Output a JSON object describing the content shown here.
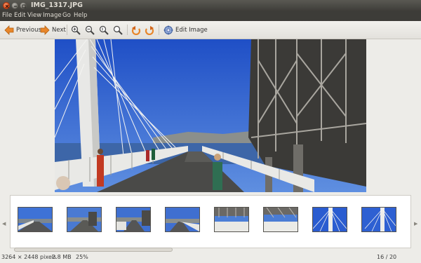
{
  "window": {
    "title": "IMG_1317.JPG"
  },
  "menu": [
    "File",
    "Edit",
    "View",
    "Image",
    "Go",
    "Help"
  ],
  "toolbar": {
    "previous_label": "Previous",
    "next_label": "Next",
    "edit_label": "Edit Image",
    "icons": [
      "go-previous-icon",
      "go-next-icon",
      "zoom-in-icon",
      "zoom-out-icon",
      "zoom-fit-icon",
      "zoom-original-icon",
      "rotate-left-icon",
      "rotate-right-icon",
      "edit-image-icon"
    ]
  },
  "image": {
    "subject": "bridge-walkway-photo"
  },
  "thumbnails": {
    "visible_count": 8
  },
  "status": {
    "dimensions": "3264 × 2448 pixels",
    "size": "2.8 MB",
    "zoom": "25%",
    "position": "16 / 20"
  },
  "colors": {
    "titlebar": "#3d3c38",
    "close_button": "#dd4814",
    "sky": "#2d5fd0",
    "background": "#edece8"
  }
}
